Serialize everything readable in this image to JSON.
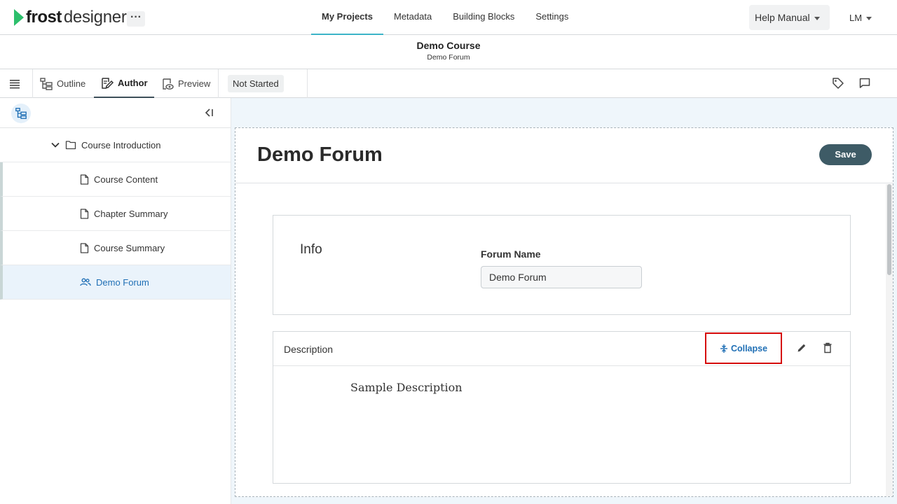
{
  "app": {
    "logo_frost": "frost",
    "logo_designer": "designer",
    "more_label": "···"
  },
  "nav": {
    "items": [
      {
        "label": "My Projects",
        "active": true
      },
      {
        "label": "Metadata",
        "active": false
      },
      {
        "label": "Building Blocks",
        "active": false
      },
      {
        "label": "Settings",
        "active": false
      }
    ],
    "help_label": "Help Manual",
    "user_label": "LM"
  },
  "course": {
    "title": "Demo Course",
    "subtitle": "Demo Forum"
  },
  "toolbar": {
    "outline_label": "Outline",
    "author_label": "Author",
    "preview_label": "Preview",
    "status_label": "Not Started"
  },
  "sidebar": {
    "parent": {
      "label": "Course Introduction"
    },
    "items": [
      {
        "label": "Course Content",
        "icon": "page-icon",
        "selected": false
      },
      {
        "label": "Chapter Summary",
        "icon": "page-icon",
        "selected": false
      },
      {
        "label": "Course Summary",
        "icon": "page-icon",
        "selected": false
      },
      {
        "label": "Demo Forum",
        "icon": "people-icon",
        "selected": true
      }
    ]
  },
  "editor": {
    "title": "Demo Forum",
    "save_label": "Save",
    "info": {
      "section_label": "Info",
      "field_label": "Forum Name",
      "field_value": "Demo Forum"
    },
    "description": {
      "section_label": "Description",
      "collapse_label": "Collapse",
      "body": "Sample Description"
    }
  },
  "colors": {
    "accent": "#3cb4c8",
    "link": "#1f6fb5",
    "save_button": "#3e5b66",
    "highlight_box": "#d60b0b",
    "logo_green": "#2dbf6c"
  }
}
